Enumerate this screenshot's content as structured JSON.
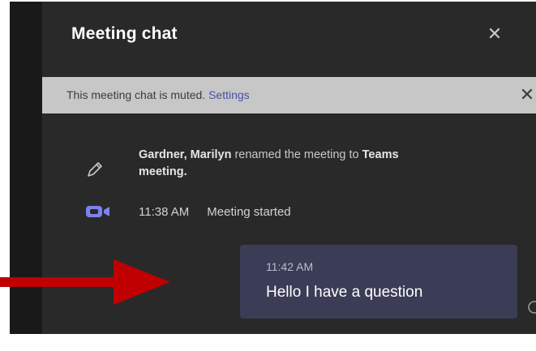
{
  "panel": {
    "title": "Meeting chat"
  },
  "banner": {
    "text": "This meeting chat is muted. ",
    "link": "Settings"
  },
  "events": {
    "rename": {
      "actor": "Gardner, Marilyn",
      "middle": " renamed the meeting to ",
      "target": "Teams meeting."
    },
    "started": {
      "time": "11:38 AM",
      "text": "Meeting started"
    }
  },
  "message": {
    "time": "11:42 AM",
    "text": "Hello I have a question"
  },
  "icons": {
    "close": "close-icon",
    "rename": "pencil-icon",
    "meeting": "video-camera-icon",
    "edge": "circle-icon",
    "pointer": "red-arrow"
  },
  "colors": {
    "panel_bg": "#292929",
    "banner_bg": "#c7c7c7",
    "link": "#4a4fa8",
    "bubble_bg": "#3b3c55",
    "video_icon": "#7b83eb",
    "arrow": "#c00000"
  }
}
